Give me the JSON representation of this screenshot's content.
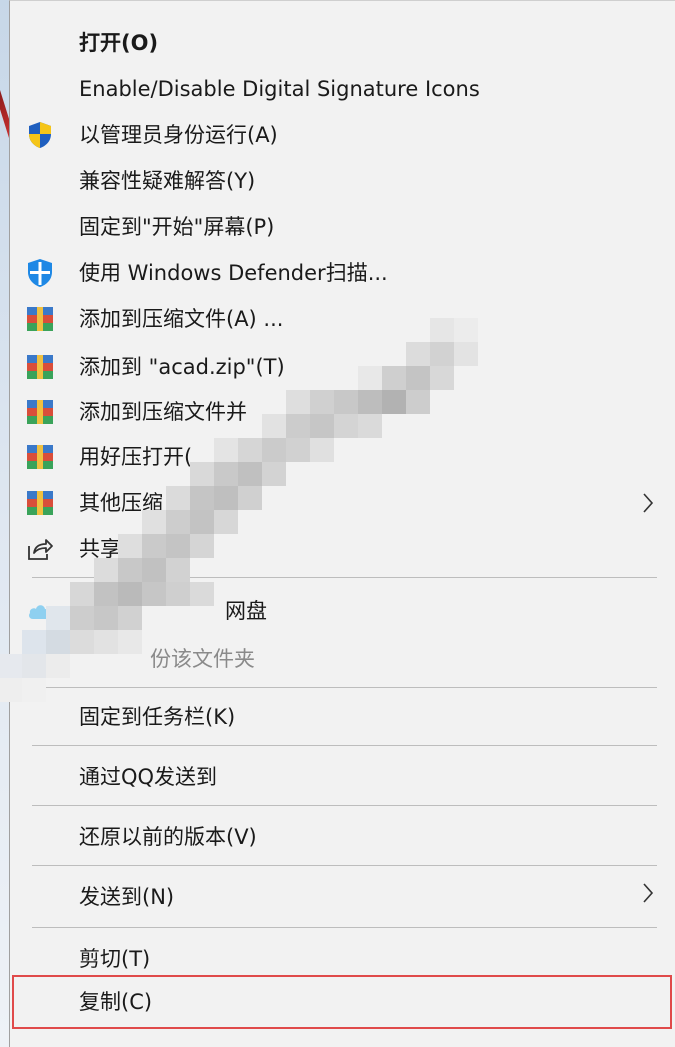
{
  "menu": {
    "items": [
      {
        "label": "打开(O)",
        "icon": "none",
        "bold": true
      },
      {
        "label": "Enable/Disable Digital Signature Icons",
        "icon": "none"
      },
      {
        "label": "以管理员身份运行(A)",
        "icon": "uac-shield-icon"
      },
      {
        "label": "兼容性疑难解答(Y)",
        "icon": "none"
      },
      {
        "label": "固定到\"开始\"屏幕(P)",
        "icon": "none"
      },
      {
        "label": "使用 Windows Defender扫描...",
        "icon": "defender-shield-icon"
      },
      {
        "label": "添加到压缩文件(A) ...",
        "icon": "winrar-archive-icon"
      },
      {
        "label": "添加到 \"acad.zip\"(T)",
        "icon": "winrar-archive-icon"
      },
      {
        "label": "添加到压缩文件并",
        "icon": "winrar-archive-icon"
      },
      {
        "label": "用好压打开(",
        "icon": "winrar-archive-icon"
      },
      {
        "label": "其他压缩",
        "icon": "winrar-archive-icon",
        "submenu": true
      },
      {
        "label": "共享",
        "icon": "share-icon"
      },
      {
        "label": "网盘",
        "icon": "cloud-icon"
      },
      {
        "label": "份该文件夹",
        "icon": "none",
        "dim": true
      },
      {
        "label": "固定到任务栏(K)",
        "icon": "none"
      },
      {
        "label": "通过QQ发送到",
        "icon": "none"
      },
      {
        "label": "还原以前的版本(V)",
        "icon": "none"
      },
      {
        "label": "发送到(N)",
        "icon": "none",
        "submenu": true
      },
      {
        "label": "剪切(T)",
        "icon": "none"
      },
      {
        "label": "复制(C)",
        "icon": "none"
      }
    ]
  },
  "colors": {
    "menu_bg": "#f2f2f2",
    "separator": "#bdbdbd",
    "highlight_border": "#e04a4a",
    "uac_blue": "#1f5fbf",
    "uac_yellow": "#f5c518",
    "defender_blue": "#1e88e5"
  }
}
